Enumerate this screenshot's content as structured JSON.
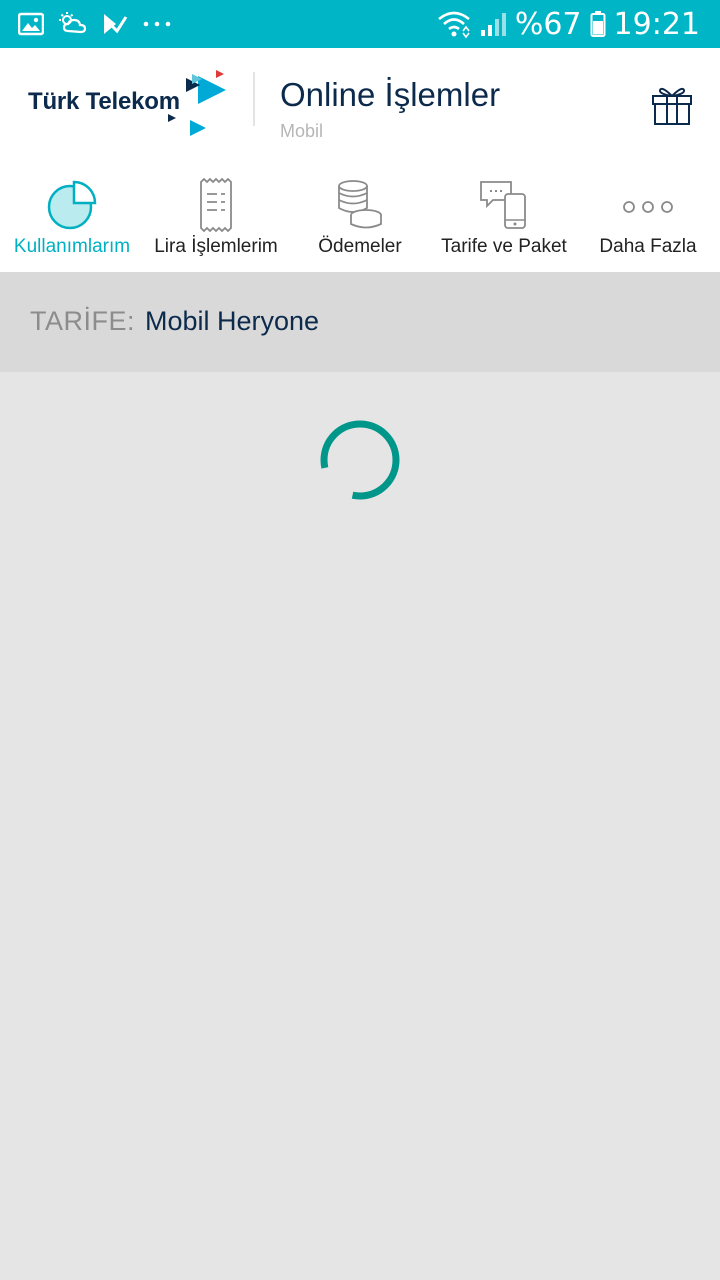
{
  "status_bar": {
    "battery": "%67",
    "time": "19:21",
    "icons": [
      "image-icon",
      "weather-icon",
      "check-app-icon",
      "more-dots-icon",
      "wifi-icon",
      "signal-icon",
      "battery-icon"
    ],
    "background": "#00b5c6"
  },
  "header": {
    "brand": "Türk Telekom",
    "title": "Online İşlemler",
    "subtitle": "Mobil",
    "gift_icon": "gift-icon"
  },
  "nav": {
    "items": [
      {
        "label": "Kullanımlarım",
        "icon": "usage-pie-icon",
        "active": true
      },
      {
        "label": "Lira İşlemlerim",
        "icon": "receipt-icon",
        "active": false
      },
      {
        "label": "Ödemeler",
        "icon": "coins-icon",
        "active": false
      },
      {
        "label": "Tarife ve Paket",
        "icon": "chat-phone-icon",
        "active": false
      },
      {
        "label": "Daha Fazla",
        "icon": "more-icon",
        "active": false
      }
    ],
    "active_color": "#00b0c2"
  },
  "tariff": {
    "key": "TARİFE:",
    "value": "Mobil Heryone"
  },
  "colors": {
    "accent": "#00b5c6",
    "navy": "#0c2a4c",
    "spinner": "#00968a"
  }
}
